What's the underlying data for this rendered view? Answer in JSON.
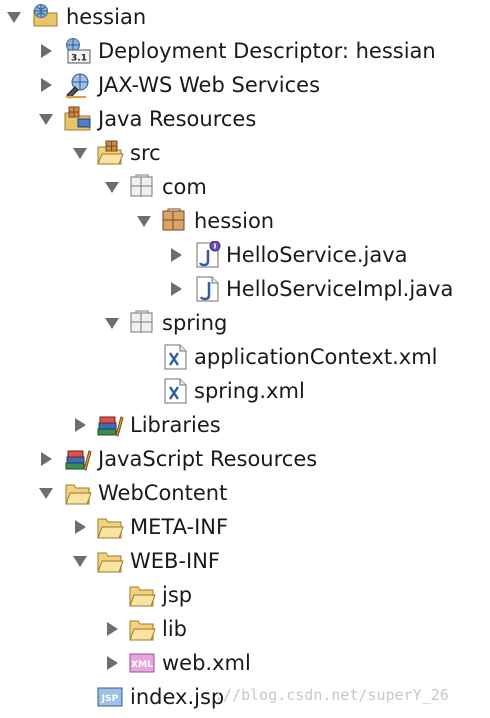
{
  "project_explorer": {
    "items": [
      {
        "label": "hessian"
      },
      {
        "label": "Deployment Descriptor: hessian"
      },
      {
        "label": "JAX-WS Web Services"
      },
      {
        "label": "Java Resources"
      },
      {
        "label": "src"
      },
      {
        "label": "com"
      },
      {
        "label": "hession"
      },
      {
        "label": "HelloService.java"
      },
      {
        "label": "HelloServiceImpl.java"
      },
      {
        "label": "spring"
      },
      {
        "label": "applicationContext.xml"
      },
      {
        "label": "spring.xml"
      },
      {
        "label": "Libraries"
      },
      {
        "label": "JavaScript Resources"
      },
      {
        "label": "WebContent"
      },
      {
        "label": "META-INF"
      },
      {
        "label": "WEB-INF"
      },
      {
        "label": "jsp"
      },
      {
        "label": "lib"
      },
      {
        "label": "web.xml"
      },
      {
        "label": "index.jsp"
      }
    ]
  },
  "icons": {
    "web_project": "web-project-icon",
    "deployment_descriptor": "deployment-descriptor-icon",
    "web_services": "web-services-icon",
    "java_resources": "java-resources-icon",
    "source_folder": "source-folder-icon",
    "package": "package-icon",
    "java_interface": "java-interface-icon",
    "java_class": "java-class-icon",
    "xml_file": "xml-file-icon",
    "libraries": "libraries-icon",
    "folder": "folder-icon",
    "web_xml": "web-xml-icon",
    "jsp_file": "jsp-file-icon"
  },
  "icon_texts": {
    "deployment_version": "3.1",
    "web_xml_badge": "XML",
    "jsp_badge": "JSP"
  },
  "watermark": "://blog.csdn.net/superY_26"
}
